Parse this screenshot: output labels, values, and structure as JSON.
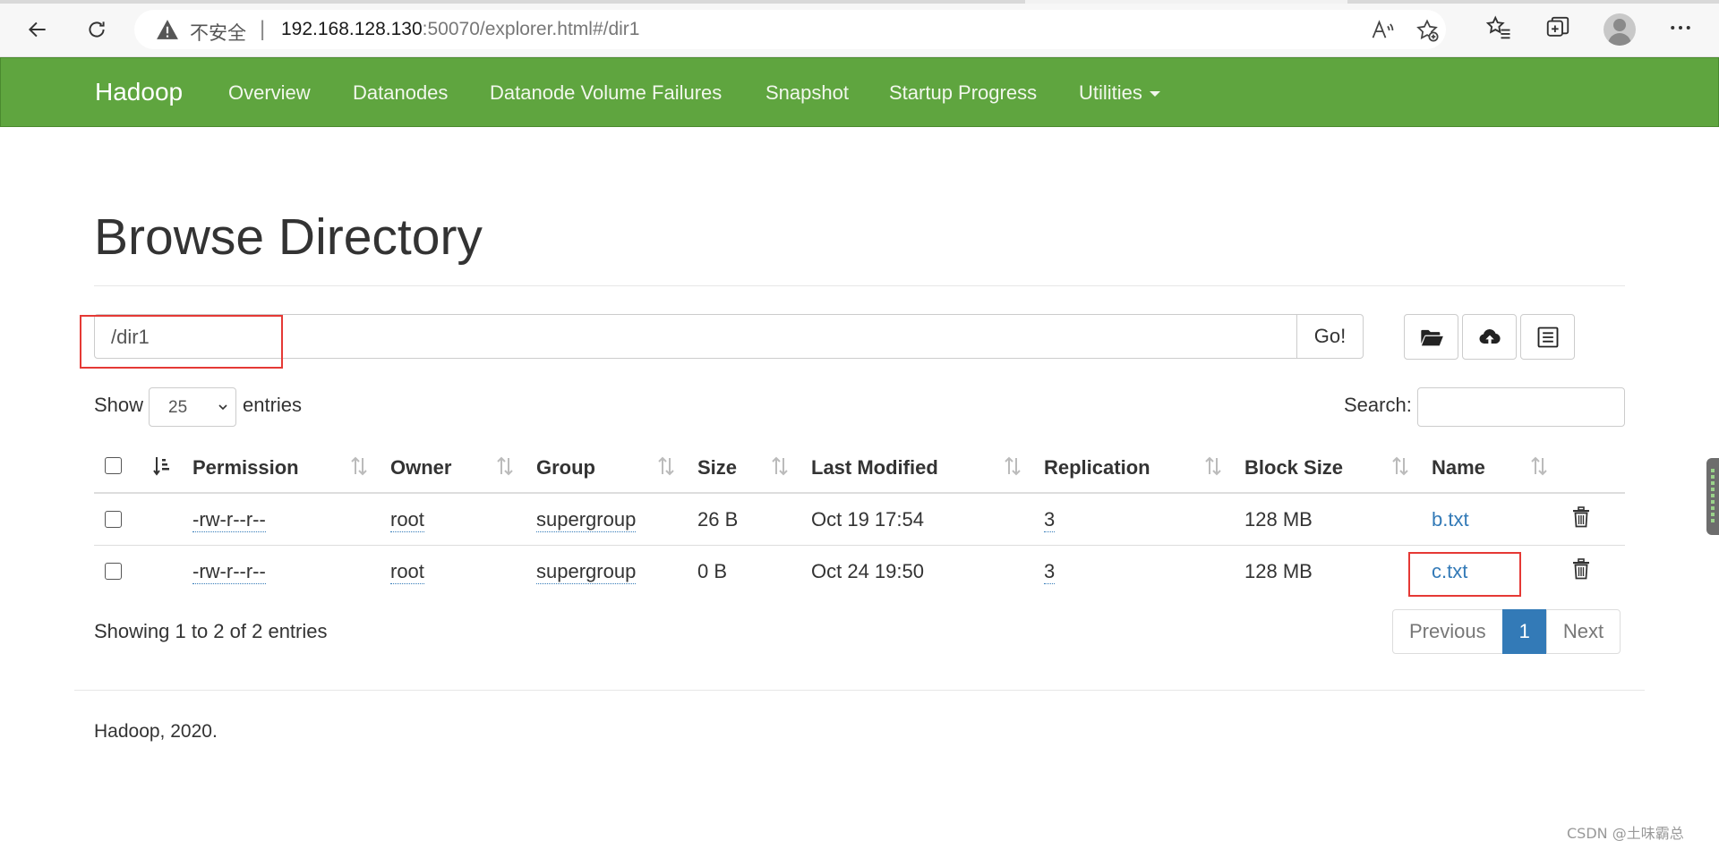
{
  "browser": {
    "insecure_label": "不安全",
    "separator": "|",
    "url_host": "192.168.128.130",
    "url_rest": ":50070/explorer.html#/dir1"
  },
  "navbar": {
    "brand": "Hadoop",
    "links": [
      "Overview",
      "Datanodes",
      "Datanode Volume Failures",
      "Snapshot",
      "Startup Progress",
      "Utilities"
    ],
    "background_color": "#5fa53f"
  },
  "page": {
    "title": "Browse Directory",
    "path_value": "/dir1",
    "go_label": "Go!",
    "icons": [
      "folder-open-icon",
      "cloud-upload-icon",
      "list-icon"
    ]
  },
  "controls": {
    "show_label": "Show",
    "entries_value": "25",
    "entries_label": "entries",
    "search_label": "Search:"
  },
  "table": {
    "headers": [
      "Permission",
      "Owner",
      "Group",
      "Size",
      "Last Modified",
      "Replication",
      "Block Size",
      "Name"
    ],
    "rows": [
      {
        "permission": "-rw-r--r--",
        "owner": "root",
        "group": "supergroup",
        "size": "26 B",
        "modified": "Oct 19 17:54",
        "replication": "3",
        "block_size": "128 MB",
        "name": "b.txt"
      },
      {
        "permission": "-rw-r--r--",
        "owner": "root",
        "group": "supergroup",
        "size": "0 B",
        "modified": "Oct 24 19:50",
        "replication": "3",
        "block_size": "128 MB",
        "name": "c.txt"
      }
    ]
  },
  "pagination": {
    "info": "Showing 1 to 2 of 2 entries",
    "previous": "Previous",
    "current": "1",
    "next": "Next"
  },
  "footer": {
    "text": "Hadoop, 2020."
  },
  "watermark": "CSDN @土味霸总",
  "colors": {
    "link": "#337ab7",
    "highlight_box": "#e53935"
  }
}
